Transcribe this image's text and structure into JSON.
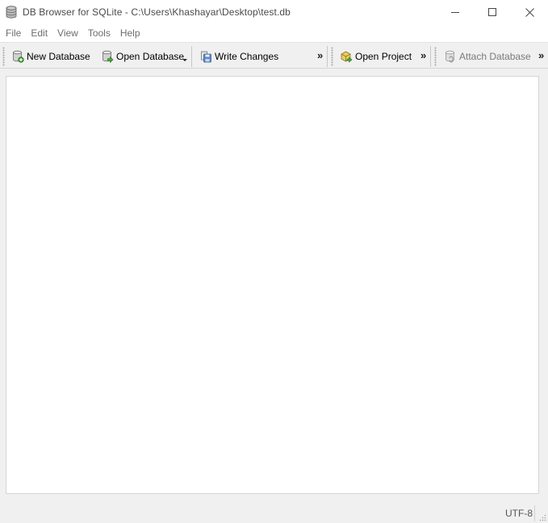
{
  "window": {
    "title": "DB Browser for SQLite - C:\\Users\\Khashayar\\Desktop\\test.db",
    "app_icon": "database-icon",
    "controls": [
      "minimize-icon",
      "maximize-icon",
      "close-icon"
    ]
  },
  "menu": {
    "items": [
      {
        "label": "File"
      },
      {
        "label": "Edit"
      },
      {
        "label": "View"
      },
      {
        "label": "Tools"
      },
      {
        "label": "Help"
      }
    ]
  },
  "toolbar": {
    "new_database": {
      "label": "New Database",
      "icon": "new-database-icon"
    },
    "open_database": {
      "label": "Open Database",
      "icon": "open-database-icon"
    },
    "write_changes": {
      "label": "Write Changes",
      "icon": "write-changes-icon"
    },
    "extension_1": "»",
    "open_project": {
      "label": "Open Project",
      "icon": "open-project-icon"
    },
    "extension_2": "»",
    "attach_database": {
      "label": "Attach Database",
      "icon": "attach-database-icon",
      "enabled": false
    },
    "extension_3": "»"
  },
  "status": {
    "encoding": "UTF-8"
  },
  "colors": {
    "titlebar": "#ffffff",
    "window_background": "#f0f0f0",
    "content_background": "#ffffff",
    "menu_text": "#6d6d6d"
  }
}
